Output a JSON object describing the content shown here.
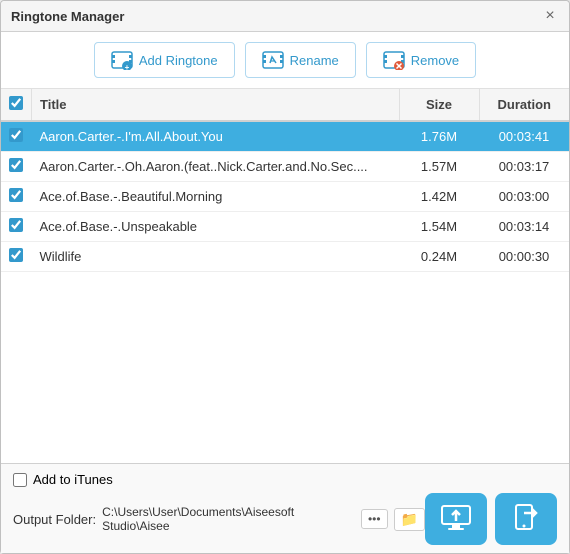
{
  "window": {
    "title": "Ringtone Manager",
    "close_label": "×"
  },
  "toolbar": {
    "add_ringtone_label": "Add Ringtone",
    "rename_label": "Rename",
    "remove_label": "Remove"
  },
  "table": {
    "headers": {
      "title": "Title",
      "size": "Size",
      "duration": "Duration"
    },
    "rows": [
      {
        "checked": true,
        "title": "Aaron.Carter.-.I'm.All.About.You",
        "size": "1.76M",
        "duration": "00:03:41",
        "selected": true
      },
      {
        "checked": true,
        "title": "Aaron.Carter.-.Oh.Aaron.(feat..Nick.Carter.and.No.Sec....",
        "size": "1.57M",
        "duration": "00:03:17",
        "selected": false
      },
      {
        "checked": true,
        "title": "Ace.of.Base.-.Beautiful.Morning",
        "size": "1.42M",
        "duration": "00:03:00",
        "selected": false
      },
      {
        "checked": true,
        "title": "Ace.of.Base.-.Unspeakable",
        "size": "1.54M",
        "duration": "00:03:14",
        "selected": false
      },
      {
        "checked": true,
        "title": "Wildlife",
        "size": "0.24M",
        "duration": "00:00:30",
        "selected": false
      }
    ]
  },
  "footer": {
    "add_to_itunes_label": "Add to iTunes",
    "output_folder_label": "Output Folder:",
    "output_path": "C:\\Users\\User\\Documents\\Aiseesoft Studio\\Aisee",
    "dots_label": "•••",
    "folder_icon": "📁",
    "transfer_to_device_title": "Transfer to Device",
    "transfer_local_title": "Transfer to Local"
  }
}
